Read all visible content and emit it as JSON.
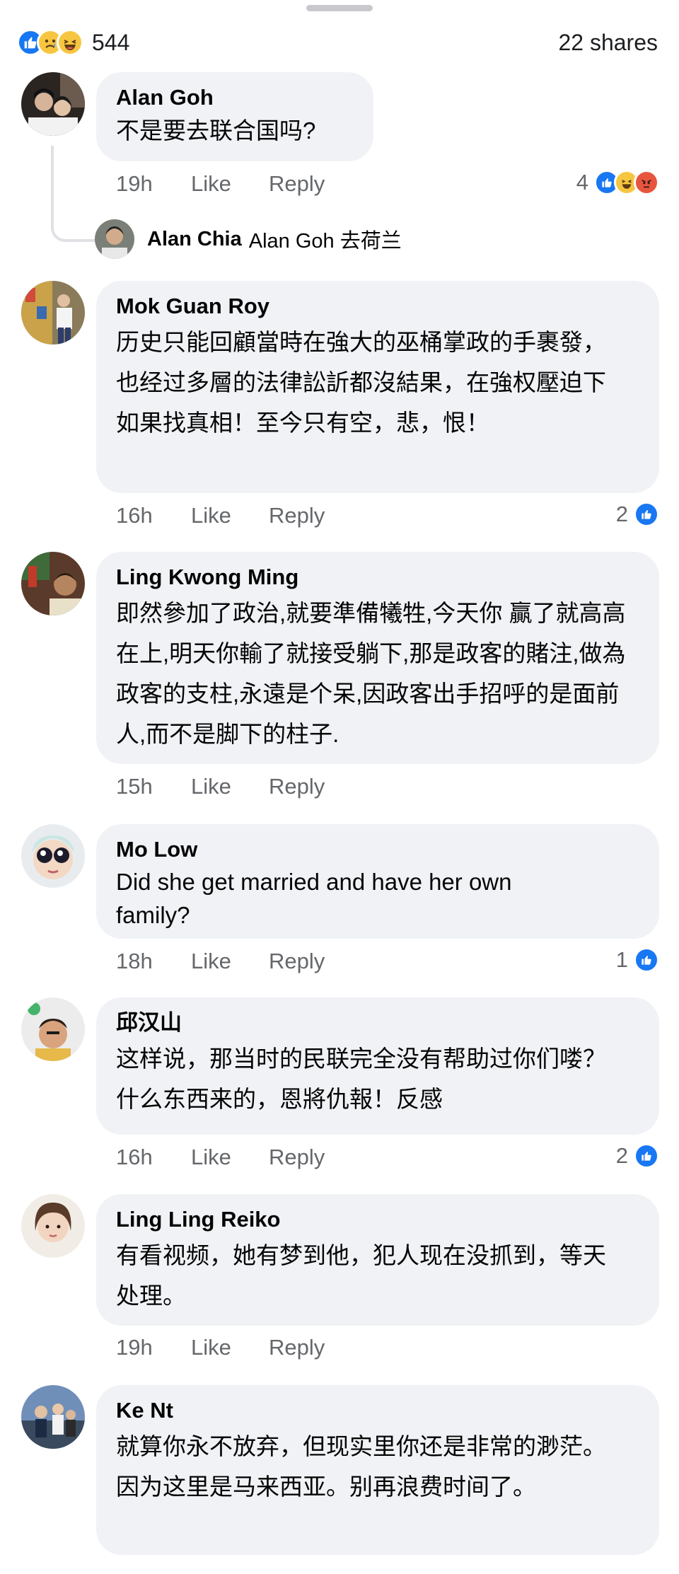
{
  "summary": {
    "reaction_count": "544",
    "shares": "22 shares"
  },
  "comments": [
    {
      "name": "Alan Goh",
      "text": "不是要去联合国吗?",
      "time": "19h",
      "like": "Like",
      "reply": "Reply",
      "reactions": "4",
      "replies": [
        {
          "name": "Alan Chia",
          "text": "Alan Goh 去荷兰"
        }
      ]
    },
    {
      "name": "Mok Guan Roy",
      "text": "历史只能回顧當時在強大的巫桶掌政的手裹發，也经过多層的法律訟訢都沒結果，在強权壓迫下如果找真相！至今只有空，悲，恨！",
      "time": "16h",
      "like": "Like",
      "reply": "Reply",
      "reactions": "2"
    },
    {
      "name": "Ling Kwong Ming",
      "text": "即然參加了政治,就要準備犧牲,今天你 贏了就高高在上,明天你輸了就接受躺下,那是政客的賭注,做為政客的支柱,永遠是个呆,因政客出手招呼的是面前人,而不是脚下的柱子.",
      "time": "15h",
      "like": "Like",
      "reply": "Reply",
      "reactions": ""
    },
    {
      "name": "Mo Low",
      "text": "Did she get married and have her own family?",
      "time": "18h",
      "like": "Like",
      "reply": "Reply",
      "reactions": "1"
    },
    {
      "name": "邱汉山",
      "text": "这样说，那当时的民联完全没有帮助过你们喽？什么东西来的，恩將仇報！反感",
      "time": "16h",
      "like": "Like",
      "reply": "Reply",
      "reactions": "2"
    },
    {
      "name": "Ling Ling Reiko",
      "text": "有看视频，她有梦到他，犯人现在没抓到，等天处理。",
      "time": "19h",
      "like": "Like",
      "reply": "Reply",
      "reactions": ""
    },
    {
      "name": "Ke Nt",
      "text": "就算你永不放弃，但现实里你还是非常的渺茫。因为这里是马来西亚。别再浪费时间了。",
      "time": "",
      "like": "",
      "reply": "",
      "reactions": ""
    }
  ],
  "colors": {
    "like_blue": "#1877f2",
    "bubble_bg": "#f0f2f5",
    "meta_gray": "#65676b"
  },
  "icons": [
    "like-icon",
    "sad-icon",
    "haha-icon",
    "angry-icon"
  ]
}
